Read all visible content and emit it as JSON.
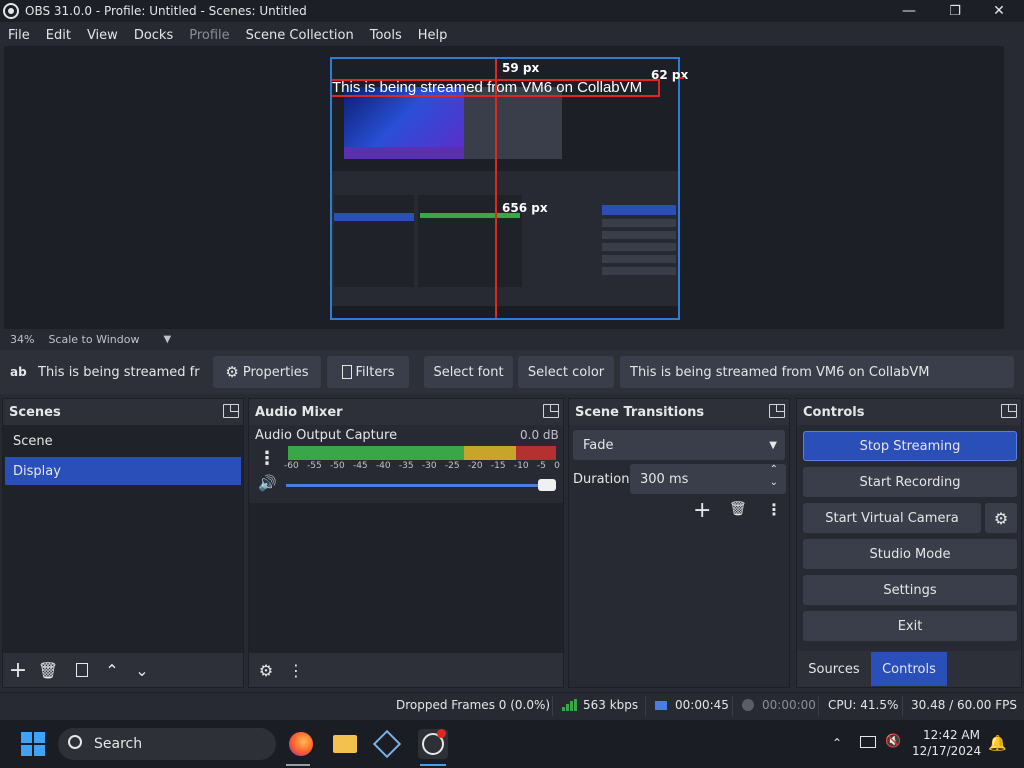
{
  "window": {
    "title": "OBS 31.0.0 - Profile: Untitled - Scenes: Untitled",
    "minimize_glyph": "—",
    "maximize_glyph": "❐",
    "close_glyph": "✕"
  },
  "menu": [
    "File",
    "Edit",
    "View",
    "Docks",
    "Profile",
    "Scene Collection",
    "Tools",
    "Help"
  ],
  "preview": {
    "zoom": "34%",
    "scale_mode": "Scale to Window",
    "text_source": "This is being streamed from VM6 on CollabVM",
    "measure_top": "59 px",
    "measure_right": "62 px",
    "measure_left": "656 px"
  },
  "source_toolbar": {
    "source_icon": "ab",
    "source_name": "This is being streamed from",
    "properties": "Properties",
    "filters": "Filters",
    "select_font": "Select font",
    "select_color": "Select color",
    "text_value": "This is being streamed from VM6 on CollabVM"
  },
  "scenes": {
    "title": "Scenes",
    "items": [
      {
        "label": "Scene",
        "selected": false
      },
      {
        "label": "Display",
        "selected": true
      }
    ]
  },
  "audio_mixer": {
    "title": "Audio Mixer",
    "channel": "Audio Output Capture",
    "level": "0.0 dB",
    "ticks": [
      "-60",
      "-55",
      "-50",
      "-45",
      "-40",
      "-35",
      "-30",
      "-25",
      "-20",
      "-15",
      "-10",
      "-5",
      "0"
    ],
    "volume": 1.0
  },
  "transitions": {
    "title": "Scene Transitions",
    "selected": "Fade",
    "duration_label": "Duration",
    "duration_value": "300 ms"
  },
  "controls": {
    "title": "Controls",
    "buttons": [
      "Stop Streaming",
      "Start Recording",
      "Start Virtual Camera",
      "Studio Mode",
      "Settings",
      "Exit"
    ],
    "tabs": [
      "Sources",
      "Controls"
    ]
  },
  "status": {
    "dropped": "Dropped Frames 0 (0.0%)",
    "bitrate": "563 kbps",
    "stream_time": "00:00:45",
    "rec_time": "00:00:00",
    "cpu": "CPU: 41.5%",
    "fps": "30.48 / 60.00 FPS"
  },
  "taskbar": {
    "search": "Search",
    "time": "12:42 AM",
    "date": "12/17/2024"
  },
  "colors": {
    "accent": "#2a4fb8",
    "preview_border": "#2f7bd9",
    "selection": "#e0261e",
    "meter_green": "#3aa64a",
    "meter_yellow": "#c6a52a",
    "meter_red": "#b5312f"
  }
}
